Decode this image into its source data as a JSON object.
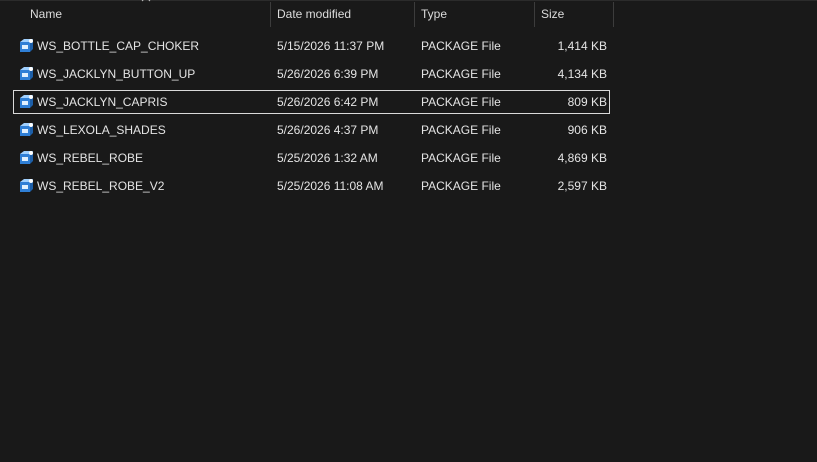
{
  "columns": {
    "name": "Name",
    "date": "Date modified",
    "type": "Type",
    "size": "Size"
  },
  "sort": {
    "column": "name",
    "direction": "ascending"
  },
  "files": [
    {
      "name": "WS_BOTTLE_CAP_CHOKER",
      "date": "5/15/2026 11:37 PM",
      "type": "PACKAGE File",
      "size": "1,414 KB",
      "icon": "package-file-icon"
    },
    {
      "name": "WS_JACKLYN_BUTTON_UP",
      "date": "5/26/2026 6:39 PM",
      "type": "PACKAGE File",
      "size": "4,134 KB",
      "icon": "package-file-icon"
    },
    {
      "name": "WS_JACKLYN_CAPRIS",
      "date": "5/26/2026 6:42 PM",
      "type": "PACKAGE File",
      "size": "809 KB",
      "icon": "package-file-icon",
      "focused": true
    },
    {
      "name": "WS_LEXOLA_SHADES",
      "date": "5/26/2026 4:37 PM",
      "type": "PACKAGE File",
      "size": "906 KB",
      "icon": "package-file-icon"
    },
    {
      "name": "WS_REBEL_ROBE",
      "date": "5/25/2026 1:32 AM",
      "type": "PACKAGE File",
      "size": "4,869 KB",
      "icon": "package-file-icon"
    },
    {
      "name": "WS_REBEL_ROBE_V2",
      "date": "5/25/2026 11:08 AM",
      "type": "PACKAGE File",
      "size": "2,597 KB",
      "icon": "package-file-icon"
    }
  ],
  "colors": {
    "background": "#191919",
    "text": "#e4e4e4",
    "focus_border": "#d9d9d9",
    "icon_blue": "#3a8ee6",
    "icon_light": "#cfe6ff"
  }
}
